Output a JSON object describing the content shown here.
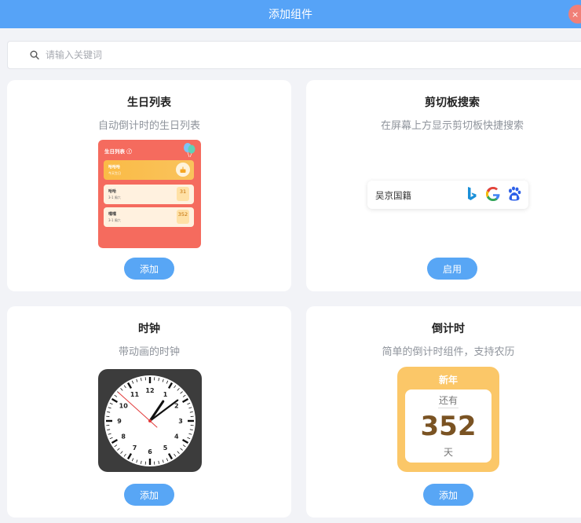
{
  "window": {
    "title": "添加组件",
    "close": "×"
  },
  "search": {
    "placeholder": "请输入关键词",
    "value": ""
  },
  "colors": {
    "accent": "#58a6f5",
    "titlebar": "#56a3f7",
    "birthday_bg": "#f56b5e",
    "countdown_bg": "#fbc768",
    "close": "#f07f77"
  },
  "cards": [
    {
      "title": "生日列表",
      "desc": "自动倒计时的生日列表",
      "button": "添加",
      "preview": {
        "header": "生日列表",
        "rows": [
          {
            "name": "哈哈哈",
            "sub": "今天生日",
            "days": ""
          },
          {
            "name": "哈哈",
            "sub": "3-1 周六",
            "days": "31"
          },
          {
            "name": "嘿嘿",
            "sub": "3-1 周六",
            "days": "352"
          }
        ]
      }
    },
    {
      "title": "剪切板搜索",
      "desc": "在屏幕上方显示剪切板快捷搜索",
      "button": "启用",
      "preview": {
        "text": "吴京国籍",
        "engines": [
          "bing-icon",
          "google-icon",
          "baidu-icon"
        ]
      }
    },
    {
      "title": "时钟",
      "desc": "带动画的时钟",
      "button": "添加",
      "preview": {
        "numbers": [
          "12",
          "1",
          "2",
          "3",
          "4",
          "5",
          "6",
          "7",
          "8",
          "9",
          "10",
          "11"
        ],
        "time": {
          "hour": 1,
          "minute": 8,
          "second": 52
        }
      }
    },
    {
      "title": "倒计时",
      "desc": "简单的倒计时组件，支持农历",
      "button": "添加",
      "preview": {
        "event": "新年",
        "prefix": "还有",
        "number": "352",
        "unit": "天"
      }
    }
  ]
}
